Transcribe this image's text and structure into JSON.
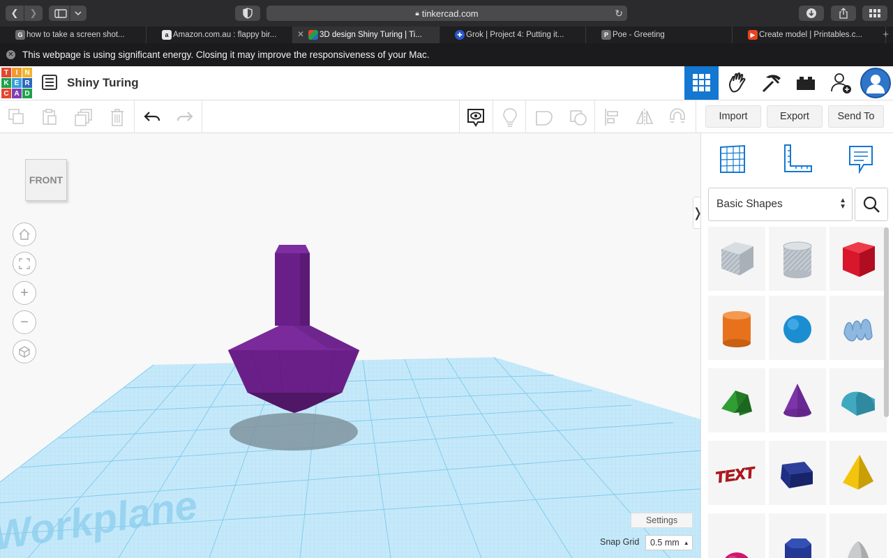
{
  "browser": {
    "url": "tinkercad.com",
    "tabs": [
      {
        "label": "how to take a screen shot...",
        "favicon": "G",
        "favicon_color": "#6b6b6b",
        "active": false
      },
      {
        "label": "Amazon.com.au : flappy bir...",
        "favicon": "a",
        "favicon_color": "#e8e8e8",
        "active": false
      },
      {
        "label": "3D design Shiny Turing | Ti...",
        "favicon": "",
        "favicon_color": "#e03b2f",
        "active": true
      },
      {
        "label": "Grok | Project 4: Putting it...",
        "favicon": "✚",
        "favicon_color": "#2a57c8",
        "active": false
      },
      {
        "label": "Poe - Greeting",
        "favicon": "P",
        "favicon_color": "#6b6b6b",
        "active": false
      },
      {
        "label": "Create model | Printables.c...",
        "favicon": "▶",
        "favicon_color": "#e8431e",
        "active": false
      }
    ],
    "energy_warning": "This webpage is using significant energy. Closing it may improve the responsiveness of your Mac."
  },
  "header": {
    "logo_letters": [
      "T",
      "I",
      "N",
      "K",
      "E",
      "R",
      "C",
      "A",
      "D"
    ],
    "logo_colors": [
      "#e2472f",
      "#f29a2e",
      "#efb72f",
      "#1fa14a",
      "#3a9fd6",
      "#2f66c0",
      "#e2472f",
      "#7c3fb5",
      "#1fa14a"
    ],
    "design_title": "Shiny Turing",
    "accent": "#1477d1"
  },
  "toolbar": {
    "import_label": "Import",
    "export_label": "Export",
    "send_to_label": "Send To"
  },
  "workspace": {
    "viewcube_label": "FRONT",
    "workplane_label": "Workplane",
    "settings_label": "Settings",
    "snap_grid_label": "Snap Grid",
    "snap_grid_value": "0.5 mm",
    "object_color": "#6a1f88",
    "grid_color": "#7ec9ec"
  },
  "panel": {
    "library_select": "Basic Shapes",
    "shapes": [
      {
        "name": "box-shape-icon",
        "color": "#b9c0c8"
      },
      {
        "name": "cylinder-hole-shape-icon",
        "color": "#c9ccd0"
      },
      {
        "name": "red-box-shape-icon",
        "color": "#d8172c"
      },
      {
        "name": "cylinder-shape-icon",
        "color": "#e8721c"
      },
      {
        "name": "sphere-shape-icon",
        "color": "#1b8ed2"
      },
      {
        "name": "scribble-shape-icon",
        "color": "#8fb8e0"
      },
      {
        "name": "roof-shape-icon",
        "color": "#2f9e33"
      },
      {
        "name": "cone-shape-icon",
        "color": "#7c34a8"
      },
      {
        "name": "round-roof-shape-icon",
        "color": "#3fa9c0"
      },
      {
        "name": "text-shape-icon",
        "color": "#c8151e"
      },
      {
        "name": "wedge-shape-icon",
        "color": "#1f2f85"
      },
      {
        "name": "pyramid-shape-icon",
        "color": "#f2c40c"
      },
      {
        "name": "half-sphere-shape-icon",
        "color": "#d5126e"
      },
      {
        "name": "polygon-shape-icon",
        "color": "#223894"
      },
      {
        "name": "paraboloid-shape-icon",
        "color": "#c9cbcd"
      }
    ],
    "text_shape_label": "TEXT"
  }
}
